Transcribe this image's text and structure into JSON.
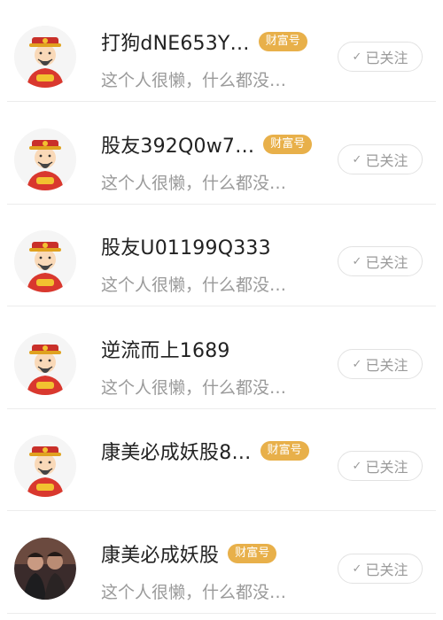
{
  "follow_list": [
    {
      "name": "打狗dNE653Y…",
      "badge": "财富号",
      "bio": "这个人很懒，什么都没…",
      "follow_label": "已关注",
      "avatar": "caishen-avatar"
    },
    {
      "name": "股友392Q0w7…",
      "badge": "财富号",
      "bio": "这个人很懒，什么都没…",
      "follow_label": "已关注",
      "avatar": "caishen-avatar"
    },
    {
      "name": "股友U01199Q333",
      "badge": "",
      "bio": "这个人很懒，什么都没…",
      "follow_label": "已关注",
      "avatar": "caishen-avatar"
    },
    {
      "name": "逆流而上1689",
      "badge": "",
      "bio": "这个人很懒，什么都没…",
      "follow_label": "已关注",
      "avatar": "caishen-avatar"
    },
    {
      "name": "康美必成妖股8…",
      "badge": "财富号",
      "bio": "",
      "follow_label": "已关注",
      "avatar": "caishen-avatar"
    },
    {
      "name": "康美必成妖股",
      "badge": "财富号",
      "bio": "这个人很懒，什么都没…",
      "follow_label": "已关注",
      "avatar": "photo-avatar"
    }
  ],
  "icons": {
    "follow_check": "✓"
  },
  "colors": {
    "badge": "#e8b04a",
    "bio": "#9a9a9a",
    "divider": "#ececec"
  }
}
